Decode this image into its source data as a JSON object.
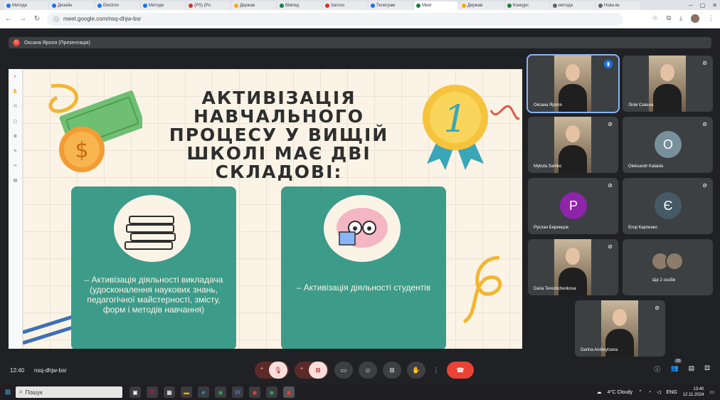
{
  "browser": {
    "tabs": [
      {
        "label": "Методи",
        "fav": "blue"
      },
      {
        "label": "Дизайн",
        "fav": "blue"
      },
      {
        "label": "Electron",
        "fav": "blue"
      },
      {
        "label": "Методи",
        "fav": "blue"
      },
      {
        "label": "(PS) (Po",
        "fav": "red"
      },
      {
        "label": "Держав",
        "fav": "yel"
      },
      {
        "label": "Вікіпед",
        "fav": "grn"
      },
      {
        "label": "Заголо",
        "fav": "red"
      },
      {
        "label": "Телеграм",
        "fav": "blue"
      },
      {
        "label": "Meet",
        "fav": "grn",
        "active": true
      },
      {
        "label": "Держав",
        "fav": "yel"
      },
      {
        "label": "Конкурс",
        "fav": "grn"
      },
      {
        "label": "метода",
        "fav": "gry"
      },
      {
        "label": "Нова вк",
        "fav": "gry"
      }
    ],
    "url": "meet.google.com/nsq-dhjw-bsr"
  },
  "meet": {
    "presenter_label": "Оксана Яроля (Презентація)",
    "presenter_initial": "О",
    "slide": {
      "title": "АКТИВІЗАЦІЯ НАВЧАЛЬНОГО ПРОЦЕСУ У ВИЩІЙ ШКОЛІ МАЄ ДВІ СКЛАДОВІ:",
      "badge_number": "1",
      "card_left_text": "– Активізація діяльності викладача (удосконалення наукових знань, педагогічної майстерності, змісту, форм і методів навчання)",
      "card_right_text": "– Активізація діяльності студентів"
    },
    "participants": [
      {
        "name": "Оксана Яроля",
        "type": "photo",
        "speaking": true
      },
      {
        "name": "Лілія Сєвєна",
        "type": "photo"
      },
      {
        "name": "Mykola Samko",
        "type": "photo"
      },
      {
        "name": "Oleksandr Kalaida",
        "type": "avatar",
        "initial": "O",
        "color": "#78909c"
      },
      {
        "name": "Руслан Беринцов",
        "type": "avatar",
        "initial": "Р",
        "color": "#8e24aa"
      },
      {
        "name": "Єгор Карпенко",
        "type": "avatar",
        "initial": "Є",
        "color": "#455a64"
      },
      {
        "name": "Daria Tereshchenkova",
        "type": "photo"
      },
      {
        "name": "Ще 2 особи",
        "type": "more"
      },
      {
        "name": "Darina Andreytseva",
        "type": "photo"
      }
    ],
    "time": "12:40",
    "meeting_code": "nsq-dhjw-bsr",
    "participant_count": "15"
  },
  "taskbar": {
    "search_placeholder": "Пошук",
    "weather": "4°C Cloudy",
    "lang": "ENG",
    "time": "13:40",
    "date": "12.11.2024"
  }
}
